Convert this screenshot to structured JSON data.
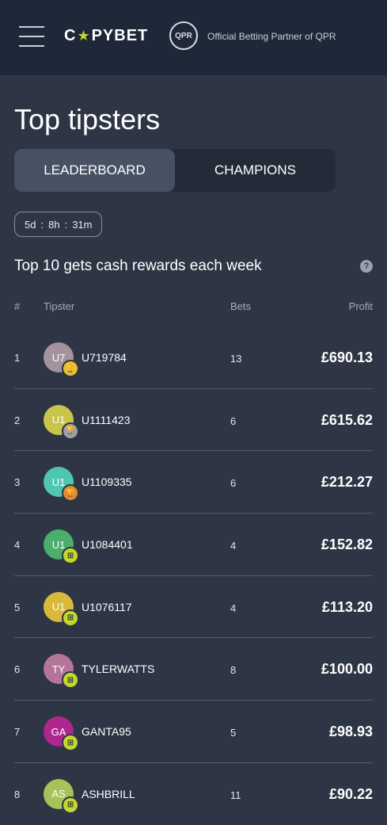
{
  "header": {
    "brand_left": "C",
    "brand_right": "PYBET",
    "partner_text": "Official Betting Partner of QPR",
    "badge_text": "QPR"
  },
  "page": {
    "title": "Top tipsters"
  },
  "tabs": [
    {
      "label": "LEADERBOARD",
      "active": true
    },
    {
      "label": "CHAMPIONS",
      "active": false
    }
  ],
  "countdown": {
    "days": "5d",
    "hours": "8h",
    "minutes": "31m",
    "separator": ":"
  },
  "rewards_text": "Top 10 gets cash rewards each week",
  "help_icon": "?",
  "table": {
    "headers": {
      "rank": "#",
      "tipster": "Tipster",
      "bets": "Bets",
      "profit": "Profit"
    },
    "rows": [
      {
        "rank": "1",
        "initials": "U7",
        "name": "U719784",
        "bets": "13",
        "profit": "£690.13",
        "avatar_color": "#a4939c",
        "medal": "gold",
        "medal_icon": "trophy-icon"
      },
      {
        "rank": "2",
        "initials": "U1",
        "name": "U1111423",
        "bets": "6",
        "profit": "£615.62",
        "avatar_color": "#c9c54a",
        "medal": "silver",
        "medal_icon": "trophy-icon"
      },
      {
        "rank": "3",
        "initials": "U1",
        "name": "U1109335",
        "bets": "6",
        "profit": "£212.27",
        "avatar_color": "#4fc7b0",
        "medal": "bronze",
        "medal_icon": "trophy-icon"
      },
      {
        "rank": "4",
        "initials": "U1",
        "name": "U1084401",
        "bets": "4",
        "profit": "£152.82",
        "avatar_color": "#4cae6c",
        "medal": "reward",
        "medal_icon": "gift-icon"
      },
      {
        "rank": "5",
        "initials": "U1",
        "name": "U1076117",
        "bets": "4",
        "profit": "£113.20",
        "avatar_color": "#d9b93c",
        "medal": "reward",
        "medal_icon": "gift-icon"
      },
      {
        "rank": "6",
        "initials": "TY",
        "name": "TYLERWATTS",
        "bets": "8",
        "profit": "£100.00",
        "avatar_color": "#b5749a",
        "medal": "reward",
        "medal_icon": "gift-icon"
      },
      {
        "rank": "7",
        "initials": "GA",
        "name": "GANTA95",
        "bets": "5",
        "profit": "£98.93",
        "avatar_color": "#b0268f",
        "medal": "reward",
        "medal_icon": "gift-icon"
      },
      {
        "rank": "8",
        "initials": "AS",
        "name": "ASHBRILL",
        "bets": "11",
        "profit": "£90.22",
        "avatar_color": "#a6c25a",
        "medal": "reward",
        "medal_icon": "gift-icon"
      }
    ]
  }
}
